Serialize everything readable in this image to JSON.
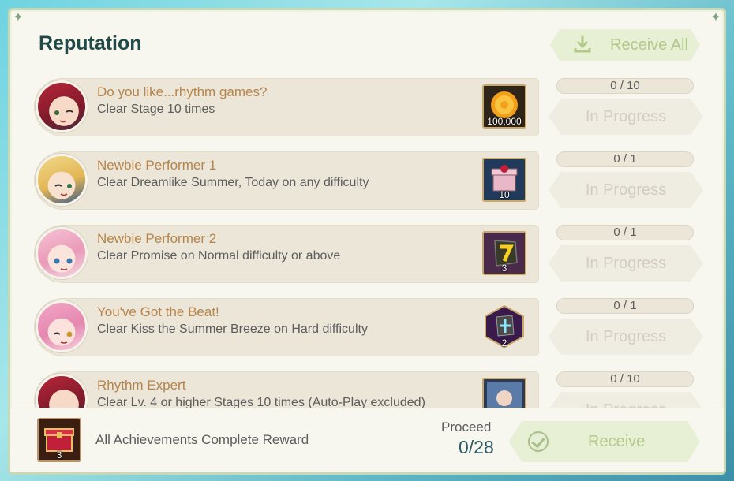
{
  "header": {
    "title": "Reputation",
    "receive_all_label": "Receive All"
  },
  "achievements": [
    {
      "title": "Do you like...rhythm games?",
      "description": "Clear Stage 10 times",
      "reward_qty": "100,000",
      "reward_icon": "gold-coin-icon",
      "progress": "0 / 10",
      "status": "In Progress"
    },
    {
      "title": "Newbie Performer 1",
      "description": "Clear Dreamlike Summer, Today on any difficulty",
      "reward_qty": "10",
      "reward_icon": "gift-box-icon",
      "progress": "0 / 1",
      "status": "In Progress"
    },
    {
      "title": "Newbie Performer 2",
      "description": "Clear Promise on Normal difficulty or above",
      "reward_qty": "3",
      "reward_icon": "yellow-gem-icon",
      "progress": "0 / 1",
      "status": "In Progress"
    },
    {
      "title": "You've Got the Beat!",
      "description": "Clear Kiss the Summer Breeze on Hard difficulty",
      "reward_qty": "2",
      "reward_icon": "blue-crystal-icon",
      "progress": "0 / 1",
      "status": "In Progress"
    },
    {
      "title": "Rhythm Expert",
      "description": "Clear Lv. 4 or higher Stages 10 times (Auto-Play excluded)",
      "reward_qty": "",
      "reward_icon": "character-card-icon",
      "progress": "0 / 10",
      "status": "In Progress"
    }
  ],
  "footer": {
    "label": "All Achievements Complete Reward",
    "reward_qty": "3",
    "reward_icon": "red-chest-icon",
    "proceed_label": "Proceed",
    "proceed_value": "0/28",
    "receive_label": "Receive"
  },
  "colors": {
    "title": "#1f4a48",
    "achievement_title": "#b7844a",
    "disabled_button_text": "#b3c98a",
    "proceed_value": "#2c5a66"
  }
}
